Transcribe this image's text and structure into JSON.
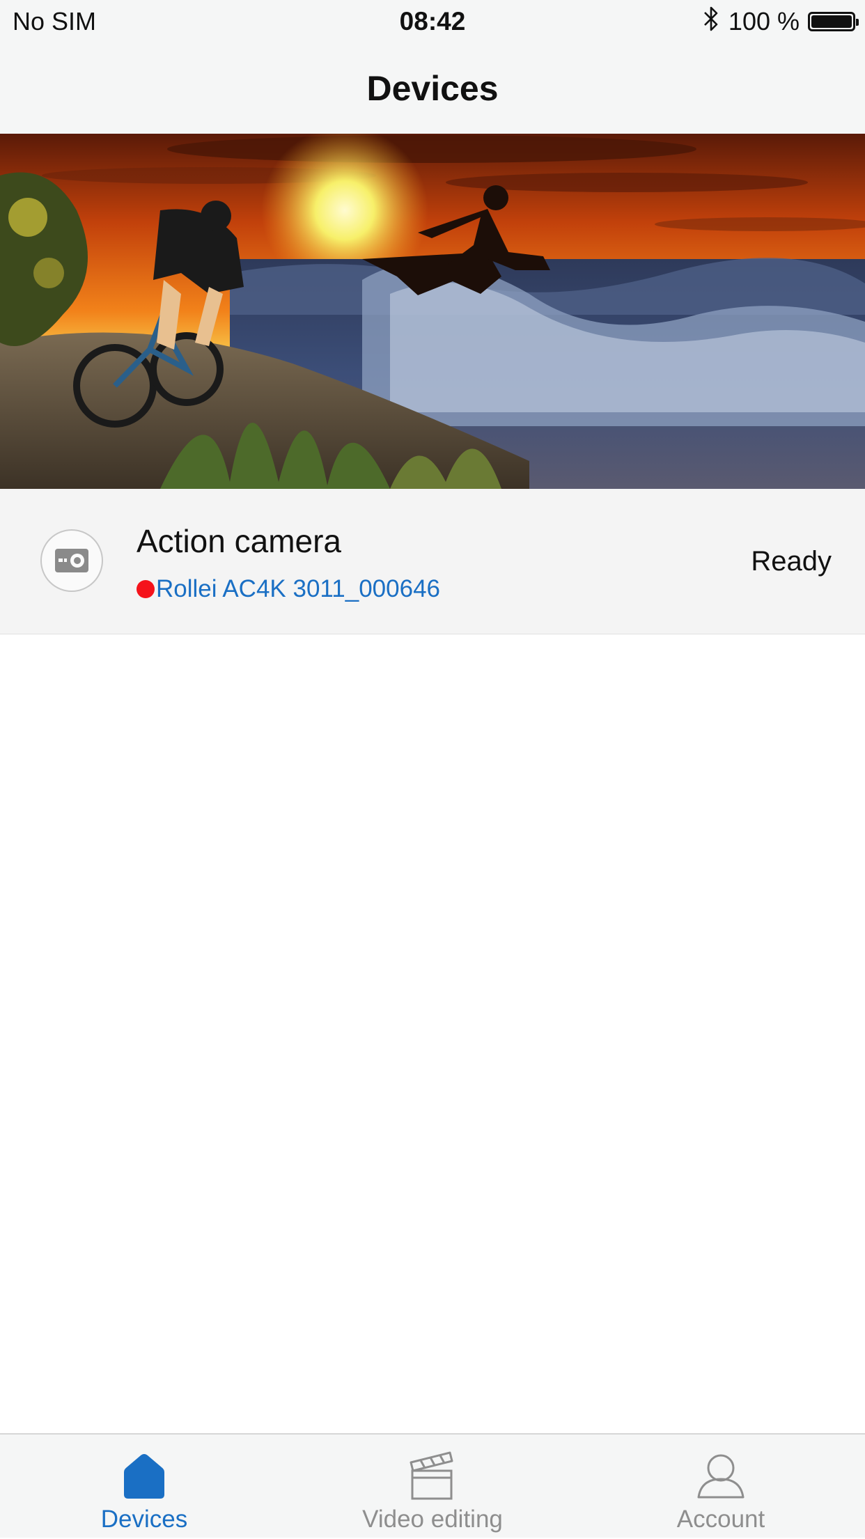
{
  "status_bar": {
    "carrier": "No SIM",
    "time": "08:42",
    "battery_percent": "100 %",
    "battery_level": 1.0,
    "bluetooth_icon": "bluetooth-icon"
  },
  "nav": {
    "title": "Devices"
  },
  "banner": {
    "icon": "action-sports-banner-image"
  },
  "device": {
    "name": "Action camera",
    "model": "Rollei AC4K 3011_000646",
    "status": "Ready",
    "icon": "action-camera-icon",
    "connection_dot_color": "#f5131b"
  },
  "tabs": [
    {
      "label": "Devices",
      "icon": "home-icon",
      "active": true
    },
    {
      "label": "Video editing",
      "icon": "clapperboard-icon",
      "active": false
    },
    {
      "label": "Account",
      "icon": "person-icon",
      "active": false
    }
  ],
  "colors": {
    "accent": "#1a6fc4",
    "inactive": "#8e8e8e",
    "bar_background": "#f5f6f6"
  }
}
